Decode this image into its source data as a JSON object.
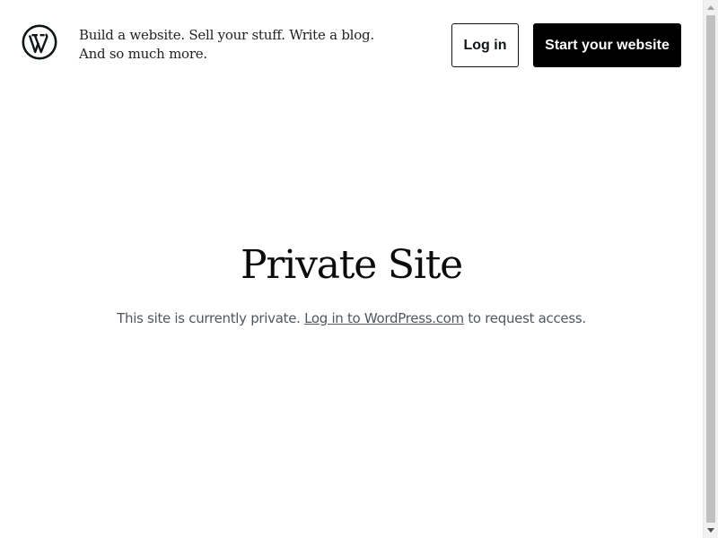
{
  "header": {
    "logo_icon": "wordpress-logo-icon",
    "tagline_line1": "Build a website. Sell your stuff. Write a blog.",
    "tagline_line2": "And so much more.",
    "login_label": "Log in",
    "start_label": "Start your website"
  },
  "main": {
    "title": "Private Site",
    "message_prefix": "This site is currently private.",
    "message_link": "Log in to WordPress.com",
    "message_suffix": "to request access."
  },
  "scrollbar": {
    "up_icon": "scroll-up-arrow-icon",
    "down_icon": "scroll-down-arrow-icon"
  },
  "colors": {
    "text_dark": "#101517",
    "button_primary_bg": "#000000",
    "button_primary_text": "#ffffff",
    "message_text": "#50575e",
    "background": "#ffffff"
  }
}
